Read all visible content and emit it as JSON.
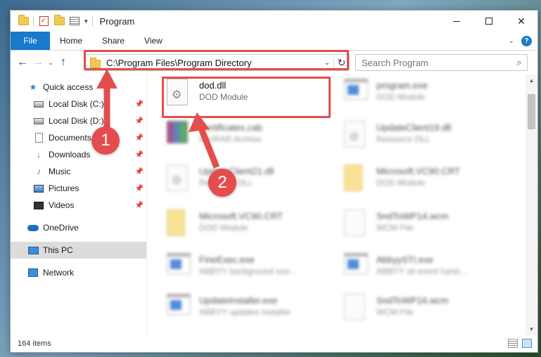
{
  "window": {
    "title": "Program",
    "check_glyph": "✓",
    "dropdown_glyph": "▾",
    "minimize_glyph": "",
    "maximize_glyph": "",
    "close_glyph": "✕"
  },
  "ribbon": {
    "tabs": [
      "File",
      "Home",
      "Share",
      "View"
    ],
    "expand_glyph": "⌄",
    "help_glyph": "?"
  },
  "nav": {
    "back_glyph": "←",
    "forward_glyph": "→",
    "recent_glyph": "⌄",
    "up_glyph": "↑",
    "address_path": "C:\\Program Files\\Program Directory",
    "address_dropdown_glyph": "⌄",
    "refresh_glyph": "↻",
    "search_placeholder": "Search Program",
    "search_glyph": "⌕"
  },
  "sidebar": {
    "items": [
      {
        "label": "Quick access",
        "icon": "star-icon",
        "glyph": "★"
      },
      {
        "label": "Local Disk (C:)",
        "icon": "drive-icon",
        "pinned": true
      },
      {
        "label": "Local Disk (D:)",
        "icon": "drive-icon",
        "pinned": true
      },
      {
        "label": "Documents",
        "icon": "documents-icon",
        "pinned": true
      },
      {
        "label": "Downloads",
        "icon": "downloads-icon",
        "glyph": "↓",
        "pinned": true
      },
      {
        "label": "Music",
        "icon": "music-icon",
        "glyph": "♪",
        "pinned": true
      },
      {
        "label": "Pictures",
        "icon": "pictures-icon",
        "pinned": true
      },
      {
        "label": "Videos",
        "icon": "videos-icon",
        "pinned": true
      },
      {
        "label": "OneDrive",
        "icon": "cloud-icon"
      },
      {
        "label": "This PC",
        "icon": "computer-icon",
        "selected": true
      },
      {
        "label": "Network",
        "icon": "network-icon"
      }
    ],
    "pin_glyph": "📌"
  },
  "files": [
    {
      "name": "dod.dll",
      "type": "DOD Module",
      "icon": "dll-file-icon",
      "highlighted": true
    },
    {
      "name": "program.exe",
      "type": "DOD Module",
      "icon": "exe-file-icon"
    },
    {
      "name": "Certificates.cab",
      "type": "WinRAR Archive",
      "icon": "archive-file-icon"
    },
    {
      "name": "UpdateClient19.dll",
      "type": "Resource DLL",
      "icon": "dll-file-icon"
    },
    {
      "name": "UpdateClient21.dll",
      "type": "Resource DLL",
      "icon": "dll-file-icon"
    },
    {
      "name": "Microsoft.VC90.CRT",
      "type": "DOD Module",
      "icon": "folder-file-icon"
    },
    {
      "name": "Microsoft.VC90.CRT",
      "type": "DOD Module",
      "icon": "folder-file-icon"
    },
    {
      "name": "SndToWP14.wcm",
      "type": "WCM File",
      "icon": "generic-file-icon"
    },
    {
      "name": "FineExec.exe",
      "type": "ABBYY background exe...",
      "icon": "exe-file-icon"
    },
    {
      "name": "AbbyySTI.exe",
      "type": "ABBYY sti event hand...",
      "icon": "exe-file-icon"
    },
    {
      "name": "UpdateInstaller.exe",
      "type": "ABBYY updates installer",
      "icon": "exe-file-icon"
    },
    {
      "name": "SndToWP16.wcm",
      "type": "WCM File",
      "icon": "generic-file-icon"
    }
  ],
  "status": {
    "item_count": "164 items"
  },
  "annotations": {
    "step1": "1",
    "step2": "2",
    "accent": "#e44d4d"
  },
  "colors": {
    "file_tab": "#1979ca",
    "selection": "#dcdcdc",
    "highlight": "#e44d4d"
  }
}
